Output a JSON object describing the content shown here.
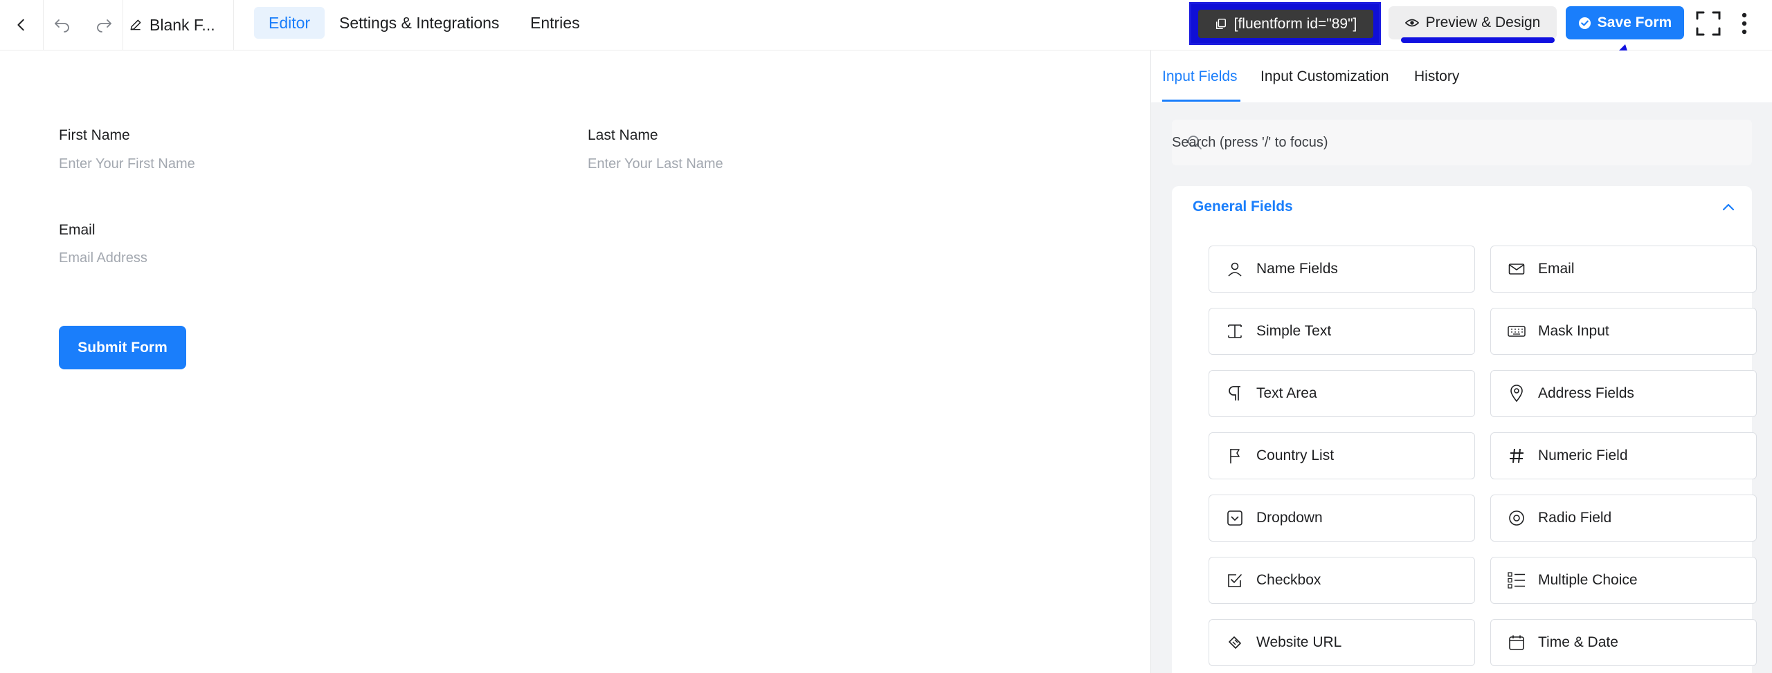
{
  "topbar": {
    "form_title": "Blank F...",
    "tabs": [
      {
        "label": "Editor"
      },
      {
        "label": "Settings & Integrations"
      },
      {
        "label": "Entries"
      }
    ],
    "shortcode": "[fluentform id=\"89\"]",
    "preview_label": "Preview & Design",
    "save_label": "Save Form"
  },
  "form": {
    "first_name": {
      "label": "First Name",
      "placeholder": "Enter Your First Name"
    },
    "last_name": {
      "label": "Last Name",
      "placeholder": "Enter Your Last Name"
    },
    "email": {
      "label": "Email",
      "placeholder": "Email Address"
    },
    "submit_label": "Submit Form"
  },
  "panel": {
    "tabs": [
      {
        "label": "Input Fields"
      },
      {
        "label": "Input Customization"
      },
      {
        "label": "History"
      }
    ],
    "search_placeholder": "Search (press '/' to focus)",
    "section_title": "General Fields",
    "fields": [
      {
        "label": "Name Fields",
        "icon": "person-icon"
      },
      {
        "label": "Email",
        "icon": "envelope-icon"
      },
      {
        "label": "Simple Text",
        "icon": "text-cursor-icon"
      },
      {
        "label": "Mask Input",
        "icon": "keyboard-icon"
      },
      {
        "label": "Text Area",
        "icon": "paragraph-icon"
      },
      {
        "label": "Address Fields",
        "icon": "map-pin-icon"
      },
      {
        "label": "Country List",
        "icon": "flag-icon"
      },
      {
        "label": "Numeric Field",
        "icon": "hash-icon"
      },
      {
        "label": "Dropdown",
        "icon": "dropdown-box-icon"
      },
      {
        "label": "Radio Field",
        "icon": "radio-icon"
      },
      {
        "label": "Checkbox",
        "icon": "checkbox-icon"
      },
      {
        "label": "Multiple Choice",
        "icon": "list-icon"
      },
      {
        "label": "Website URL",
        "icon": "link-icon"
      },
      {
        "label": "Time & Date",
        "icon": "calendar-icon"
      }
    ]
  },
  "colors": {
    "accent": "#1a7efb",
    "annotation": "#1010e0"
  }
}
